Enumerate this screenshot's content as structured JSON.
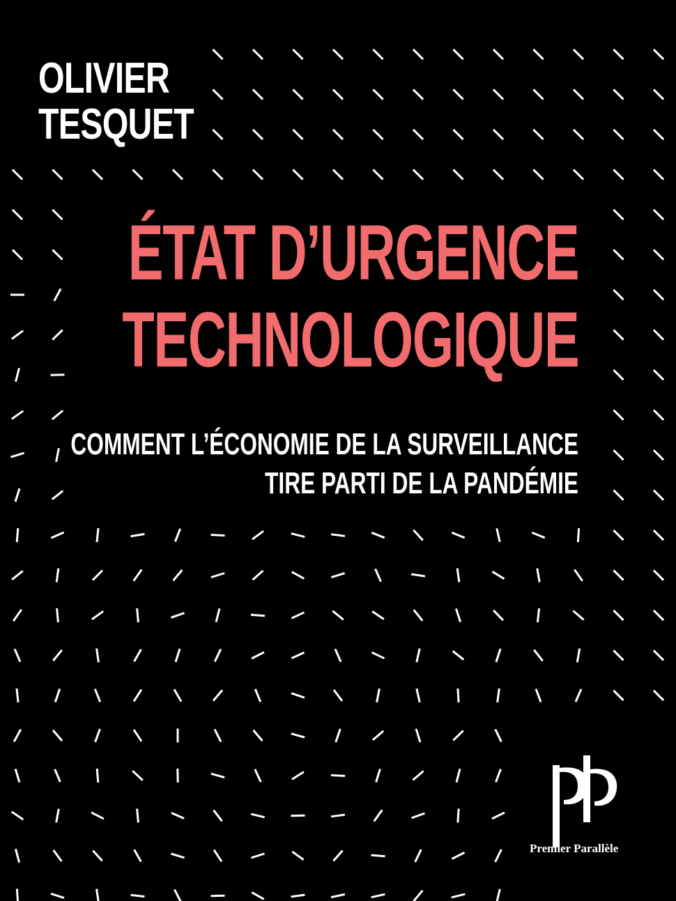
{
  "author": {
    "first": "OLIVIER",
    "last": "TESQUET"
  },
  "title": {
    "line1": "ÉTAT D’URGENCE",
    "line2": "TECHNOLOGIQUE"
  },
  "subtitle": {
    "line1": "COMMENT L’ÉCONOMIE DE LA SURVEILLANCE",
    "line2": "TIRE PARTI DE LA PANDÉMIE"
  },
  "publisher": {
    "name": "Premier Parallèle"
  },
  "colors": {
    "background": "#000000",
    "title": "#f26b6d",
    "text": "#ffffff"
  }
}
